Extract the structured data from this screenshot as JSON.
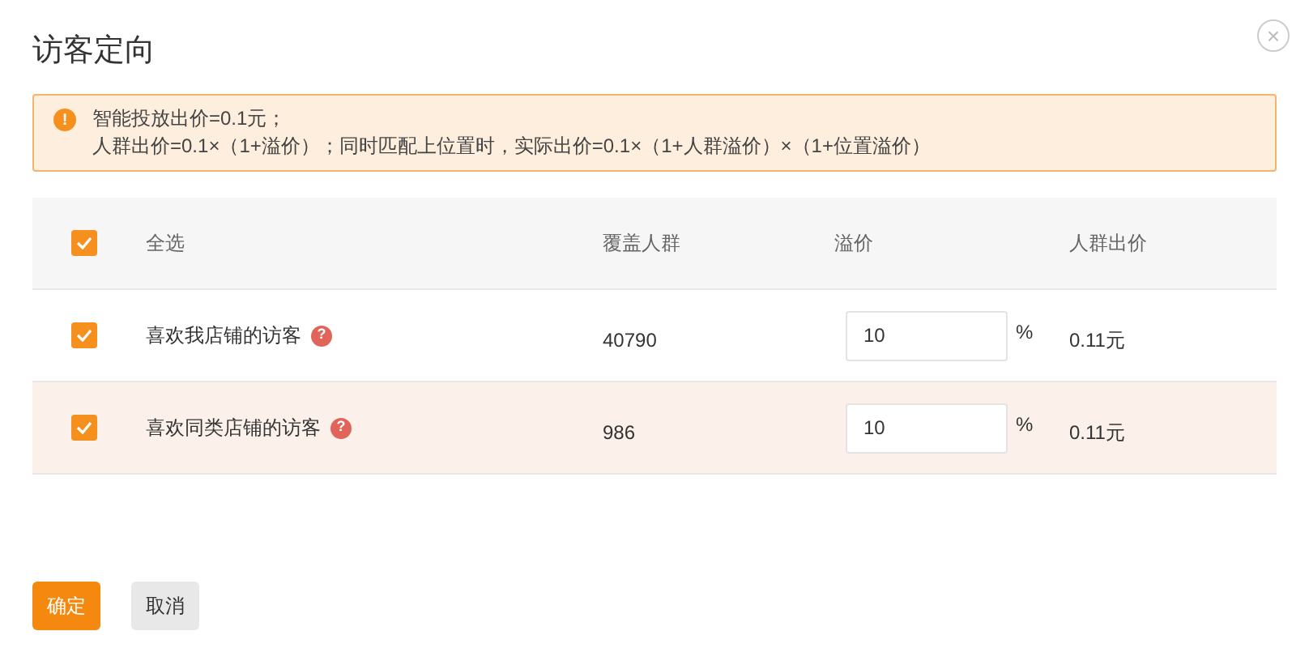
{
  "dialog": {
    "title": "访客定向",
    "close_label": "×"
  },
  "alert": {
    "icon": "!",
    "lines": [
      "智能投放出价=0.1元；",
      "人群出价=0.1×（1+溢价）；同时匹配上位置时，实际出价=0.1×（1+人群溢价）×（1+位置溢价）"
    ]
  },
  "table": {
    "select_all": {
      "label": "全选",
      "checked": true
    },
    "columns": [
      "覆盖人群",
      "溢价",
      "人群出价"
    ],
    "rows": [
      {
        "checked": true,
        "highlighted": false,
        "name": "喜欢我店铺的访客",
        "help": "?",
        "coverage": "40790",
        "premium": "10",
        "unit": "%",
        "price": "0.11元"
      },
      {
        "checked": true,
        "highlighted": true,
        "name": "喜欢同类店铺的访客",
        "help": "?",
        "coverage": "986",
        "premium": "10",
        "unit": "%",
        "price": "0.11元"
      }
    ]
  },
  "buttons": [
    {
      "kind": "primary",
      "label": "确定"
    },
    {
      "kind": "secondary",
      "label": "取消"
    }
  ]
}
